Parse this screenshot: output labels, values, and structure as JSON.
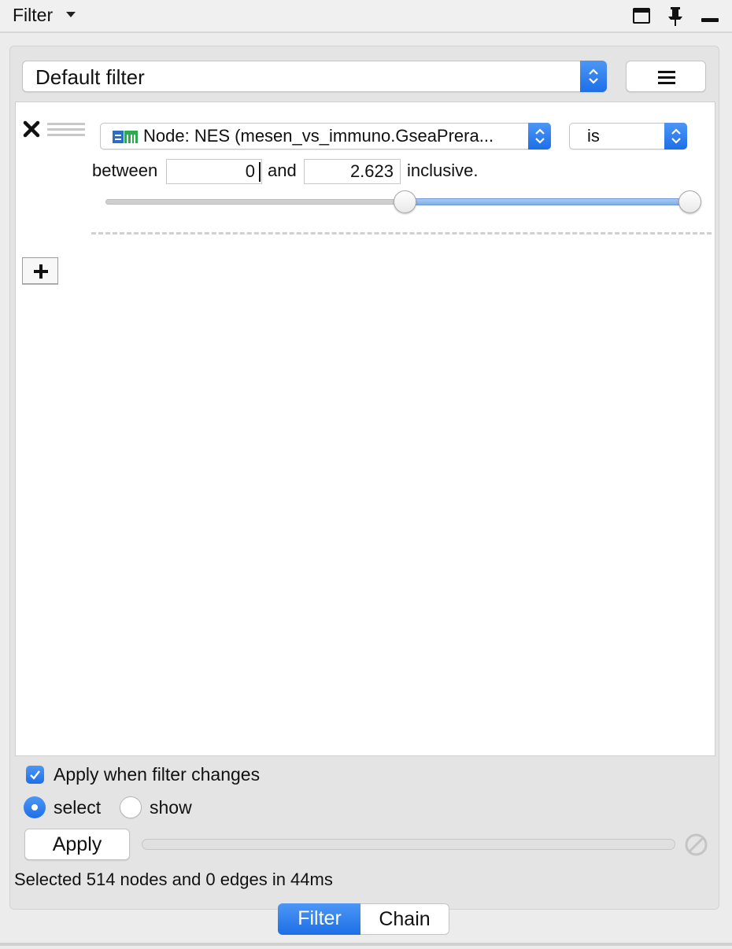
{
  "window": {
    "title": "Filter"
  },
  "filter": {
    "name": "Default filter"
  },
  "condition": {
    "column": "Node: NES (mesen_vs_immuno.GseaPrera...",
    "operator": "is",
    "between_label": "between",
    "min_value": "0",
    "and_label": "and",
    "max_value": "2.623",
    "inclusive_label": "inclusive.",
    "slider": {
      "min": 0,
      "max": 2.623,
      "low_fraction": 0.51,
      "high_fraction": 1.0
    }
  },
  "options": {
    "apply_on_change_label": "Apply when filter changes",
    "apply_on_change_checked": true,
    "mode_select_label": "select",
    "mode_show_label": "show",
    "mode_selected": "select"
  },
  "actions": {
    "apply_label": "Apply"
  },
  "status": {
    "message": "Selected 514 nodes and 0 edges in 44ms"
  },
  "tabs": [
    {
      "label": "Filter",
      "active": true
    },
    {
      "label": "Chain",
      "active": false
    }
  ],
  "colors": {
    "accent": "#1e6fe8",
    "slider_fill": "#7eaee9",
    "node_icon_blue": "#2a6fc1",
    "node_icon_green": "#2fa84f"
  }
}
